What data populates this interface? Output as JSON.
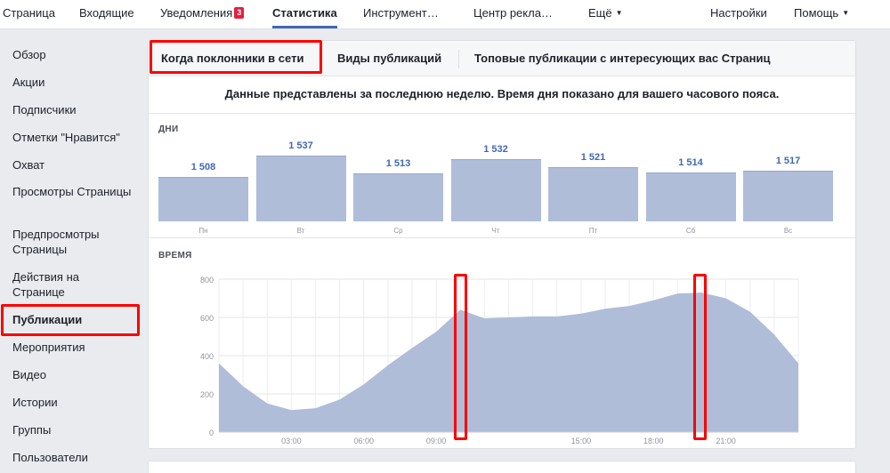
{
  "nav": {
    "items": [
      "Страница",
      "Входящие",
      "Уведомления",
      "Статистика",
      "Инструмент…",
      "Центр рекла…",
      "Ещё",
      "Настройки",
      "Помощь"
    ],
    "notifications_badge": "3"
  },
  "sidebar": {
    "items": [
      "Обзор",
      "Акции",
      "Подписчики",
      "Отметки \"Нравится\"",
      "Охват",
      "Просмотры Страницы",
      "Предпросмотры Страницы",
      "Действия на Странице",
      "Публикации",
      "Мероприятия",
      "Видео",
      "Истории",
      "Группы",
      "Пользователи"
    ]
  },
  "tabs": [
    "Когда поклонники в сети",
    "Виды публикаций",
    "Топовые публикации с интересующих вас Страниц"
  ],
  "notice": "Данные представлены за последнюю неделю. Время дня показано для вашего часового пояса.",
  "days_section": {
    "label": "ДНИ",
    "days": [
      {
        "label": "Пн",
        "value": "1 508",
        "number": 1508
      },
      {
        "label": "Вт",
        "value": "1 537",
        "number": 1537
      },
      {
        "label": "Ср",
        "value": "1 513",
        "number": 1513
      },
      {
        "label": "Чт",
        "value": "1 532",
        "number": 1532
      },
      {
        "label": "Пт",
        "value": "1 521",
        "number": 1521
      },
      {
        "label": "Сб",
        "value": "1 514",
        "number": 1514
      },
      {
        "label": "Вс",
        "value": "1 517",
        "number": 1517
      }
    ]
  },
  "time_section": {
    "label": "ВРЕМЯ",
    "chart_data": {
      "type": "area",
      "y_ticks": [
        "800",
        "600",
        "400",
        "200",
        "0"
      ],
      "ylim": [
        0,
        800
      ],
      "x_ticks": [
        "03:00",
        "06:00",
        "09:00",
        "15:00",
        "18:00",
        "21:00"
      ],
      "x_tick_hours": [
        3,
        6,
        9,
        15,
        18,
        21
      ],
      "x_hours": [
        0,
        1,
        2,
        3,
        4,
        5,
        6,
        7,
        8,
        9,
        10,
        11,
        12,
        13,
        14,
        15,
        16,
        17,
        18,
        19,
        20,
        21,
        22,
        23,
        24
      ],
      "values": [
        360,
        240,
        150,
        115,
        125,
        170,
        250,
        350,
        440,
        525,
        640,
        595,
        600,
        605,
        605,
        620,
        645,
        660,
        690,
        725,
        730,
        700,
        630,
        510,
        360
      ],
      "grid": true
    }
  },
  "colors": {
    "accent": "#4267b2",
    "bar_fill": "#afbdd9",
    "highlight": "#ff0000",
    "badge": "#e41e3f"
  }
}
